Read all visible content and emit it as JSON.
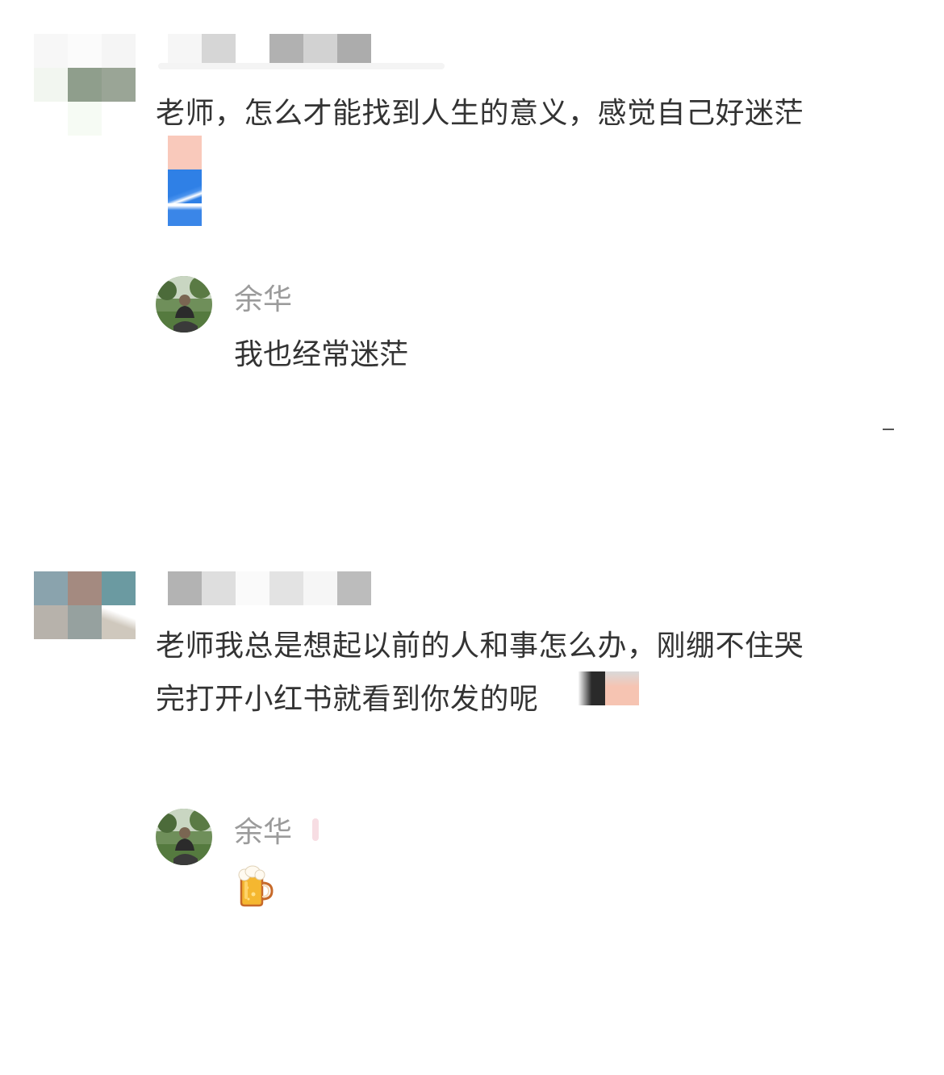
{
  "comments": [
    {
      "text": "老师，怎么才能找到人生的意义，感觉自己好迷茫",
      "reply": {
        "author": "余华",
        "text": "我也经常迷茫"
      }
    },
    {
      "text_line1": "老师我总是想起以前的人和事怎么办，刚绷不住哭",
      "text_line2": "完打开小红书就看到你发的呢",
      "reply": {
        "author": "余华",
        "emoji_icon": "beer-mug-icon"
      }
    }
  ],
  "colors": {
    "text": "#333333",
    "secondary": "#9b9b9b"
  }
}
